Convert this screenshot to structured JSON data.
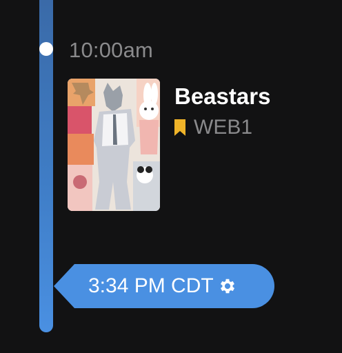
{
  "timeline": {
    "slot_time": "10:00am"
  },
  "show": {
    "title": "Beastars",
    "network": "WEB1",
    "bookmark_color": "#f0b429"
  },
  "now_indicator": {
    "time": "3:34 PM CDT",
    "icon": "gear-icon",
    "color": "#4a90e2"
  }
}
